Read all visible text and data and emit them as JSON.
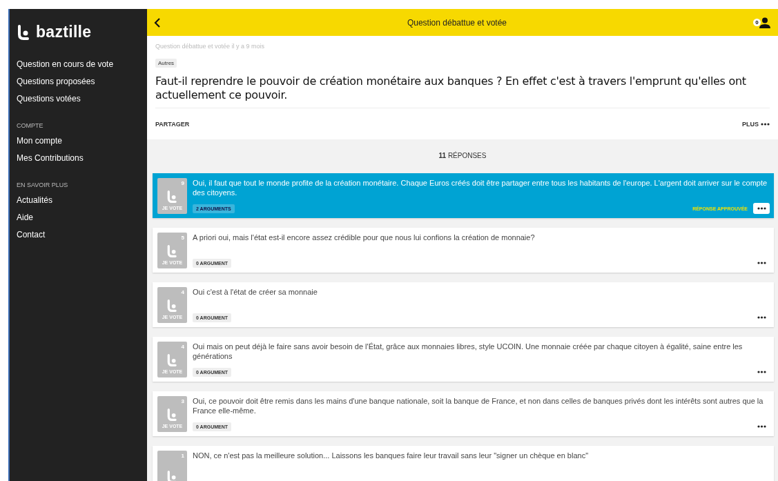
{
  "sidebar": {
    "logo": "baztille",
    "groups": [
      {
        "items": [
          {
            "label": "Question en cours de vote"
          },
          {
            "label": "Questions proposées"
          },
          {
            "label": "Questions votées"
          }
        ]
      },
      {
        "heading": "COMPTE",
        "items": [
          {
            "label": "Mon compte"
          },
          {
            "label": "Mes Contributions"
          }
        ]
      },
      {
        "heading": "EN SAVOIR PLUS",
        "items": [
          {
            "label": "Actualités"
          },
          {
            "label": "Aide"
          },
          {
            "label": "Contact"
          }
        ]
      }
    ]
  },
  "header": {
    "title": "Question débattue et votée",
    "badge": "0"
  },
  "question": {
    "meta": "Question débattue et votée il y a 9 mois",
    "tag": "Autres",
    "title": "Faut-il reprendre le pouvoir de création monétaire aux banques ? En effet c'est à travers l'emprunt qu'elles ont actuellement ce pouvoir.",
    "share": "PARTAGER",
    "more": "PLUS"
  },
  "answers_count": {
    "number": "11",
    "label": "RÉPONSES"
  },
  "answers": [
    {
      "text": "Oui, il faut que tout le monde profite de la création monétaire. Chaque Euros créés doit être partager entre tous les habitants de l'europe. L'argent doit arriver sur le compte des citoyens.",
      "votes": "9",
      "vote_label": "JE VOTE",
      "arguments": "2 ARGUMENTS",
      "approved": true,
      "approved_label": "RÉPONSE APPROUVÉE"
    },
    {
      "text": "A priori oui, mais l'état est-il encore assez crédible pour que nous lui confions la création de monnaie?",
      "votes": "5",
      "vote_label": "JE VOTE",
      "arguments": "0 ARGUMENT",
      "approved": false
    },
    {
      "text": "Oui c'est à l'état de créer sa monnaie",
      "votes": "4",
      "vote_label": "JE VOTE",
      "arguments": "0 ARGUMENT",
      "approved": false
    },
    {
      "text": "Oui mais on peut déjà le faire sans avoir besoin de l'État, grâce aux monnaies libres, style UCOIN. Une monnaie créée par chaque citoyen à égalité, saine entre les générations",
      "votes": "4",
      "vote_label": "JE VOTE",
      "arguments": "0 ARGUMENT",
      "approved": false
    },
    {
      "text": "Oui, ce pouvoir doit être remis dans les mains d'une banque nationale, soit la banque de France, et non dans celles de banques privés dont les intérêts sont autres que la France elle-même.",
      "votes": "3",
      "vote_label": "JE VOTE",
      "arguments": "0 ARGUMENT",
      "approved": false
    },
    {
      "text": "NON, ce n'est pas la meilleure solution... Laissons les banques faire leur travail sans leur \"signer un chèque en blanc\"",
      "votes": "1",
      "approved": false
    }
  ]
}
